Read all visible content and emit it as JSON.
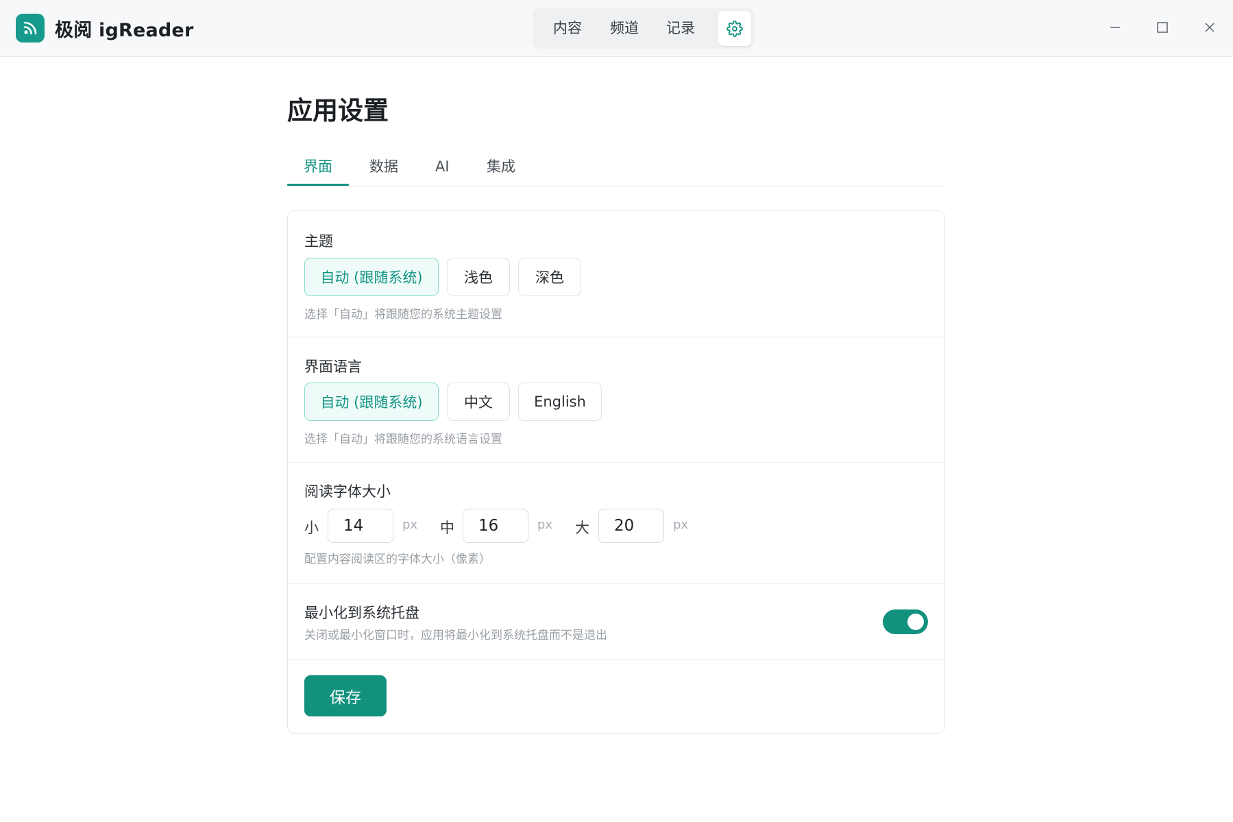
{
  "app": {
    "name": "极阅 igReader"
  },
  "nav": {
    "items": [
      "内容",
      "频道",
      "记录"
    ]
  },
  "page": {
    "title": "应用设置"
  },
  "tabs": [
    {
      "label": "界面",
      "active": true
    },
    {
      "label": "数据",
      "active": false
    },
    {
      "label": "AI",
      "active": false
    },
    {
      "label": "集成",
      "active": false
    }
  ],
  "theme": {
    "label": "主题",
    "options": [
      "自动 (跟随系统)",
      "浅色",
      "深色"
    ],
    "selected": "自动 (跟随系统)",
    "hint": "选择「自动」将跟随您的系统主题设置"
  },
  "language": {
    "label": "界面语言",
    "options": [
      "自动 (跟随系统)",
      "中文",
      "English"
    ],
    "selected": "自动 (跟随系统)",
    "hint": "选择「自动」将跟随您的系统语言设置"
  },
  "font_size": {
    "label": "阅读字体大小",
    "small_label": "小",
    "small_value": "14",
    "medium_label": "中",
    "medium_value": "16",
    "large_label": "大",
    "large_value": "20",
    "unit": "px",
    "hint": "配置内容阅读区的字体大小（像素）"
  },
  "tray": {
    "label": "最小化到系统托盘",
    "hint": "关闭或最小化窗口时，应用将最小化到系统托盘而不是退出",
    "enabled": true
  },
  "save": {
    "label": "保存"
  },
  "colors": {
    "accent": "#12917f",
    "accent_light": "#eefbf8",
    "logo_bg": "#169a8c"
  }
}
